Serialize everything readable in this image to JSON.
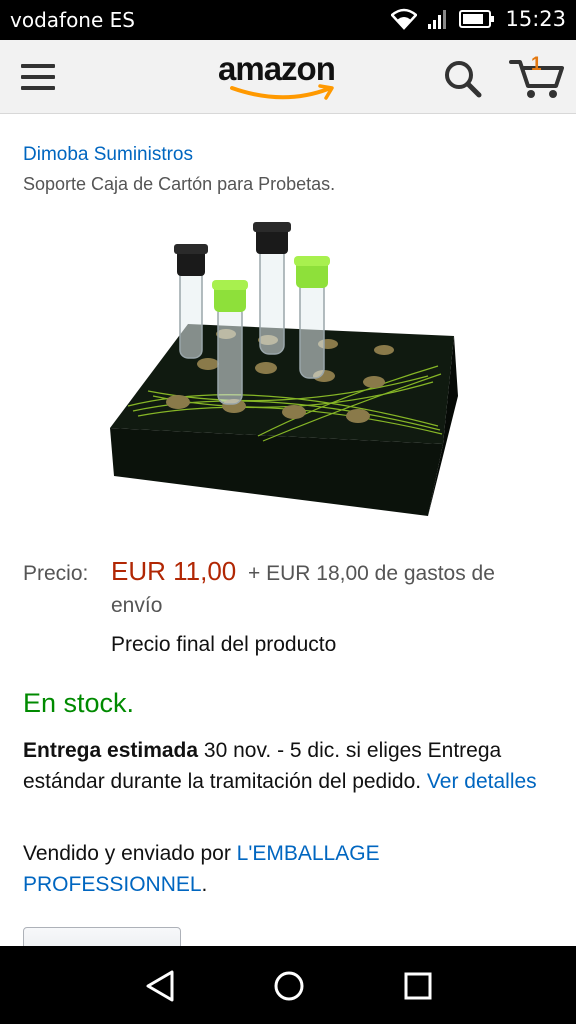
{
  "status_bar": {
    "carrier": "vodafone ES",
    "time": "15:23"
  },
  "header": {
    "logo_text": "amazon",
    "cart_count": "1"
  },
  "product": {
    "seller": "Dimoba Suministros",
    "title": "Soporte Caja de Cartón para Probetas."
  },
  "pricing": {
    "label": "Precio:",
    "price": "EUR 11,00",
    "shipping_line1": "+ EUR 18,00 de gastos de",
    "shipping_line2": "envío",
    "final_note": "Precio final del producto"
  },
  "availability": {
    "stock": "En stock.",
    "delivery_label": "Entrega estimada",
    "delivery_text": " 30 nov. - 5 dic. si eliges Entrega estándar durante la tramitación del pedido. ",
    "details_link": "Ver detalles",
    "sold_by_text": "Vendido y enviado por ",
    "sold_by_link": "L'EMBALLAGE PROFESSIONNEL",
    "sold_by_end": "."
  },
  "colors": {
    "link": "#0066c0",
    "price": "#b12704",
    "stock": "#008a00",
    "accent": "#ff9900"
  }
}
